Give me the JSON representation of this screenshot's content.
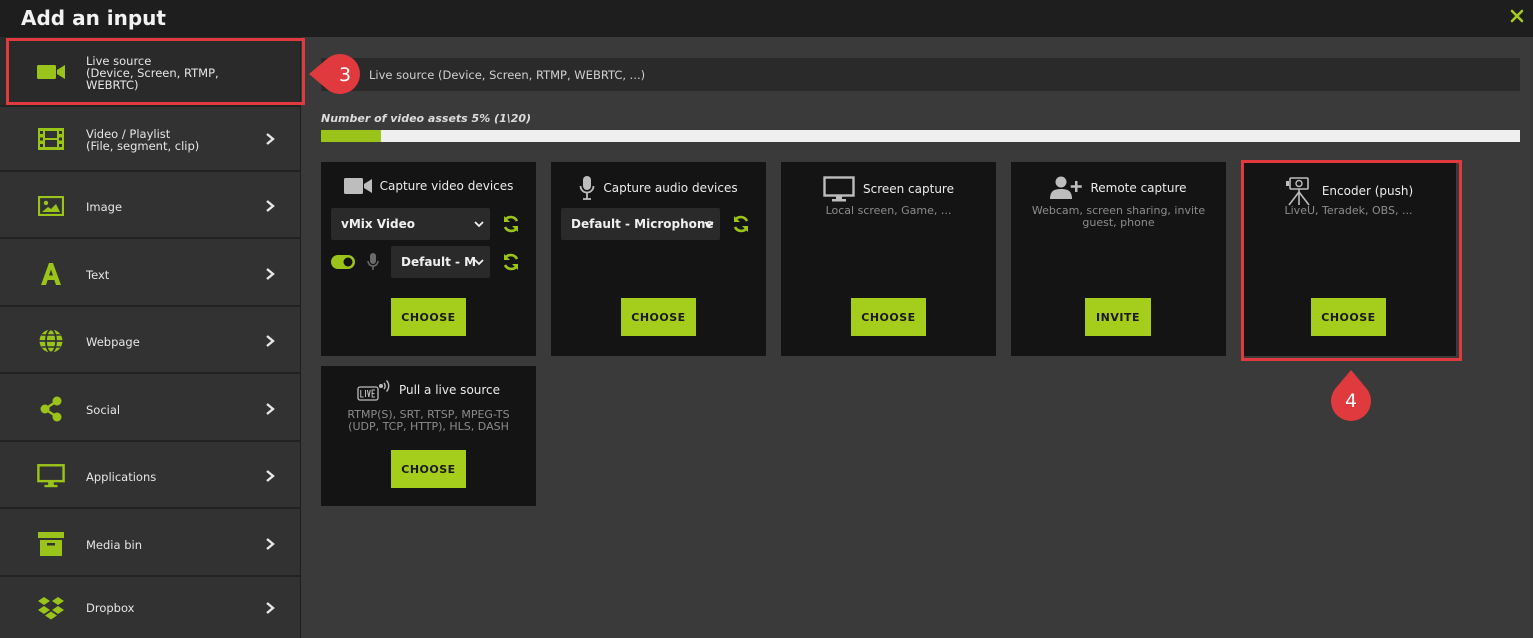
{
  "window": {
    "title": "Add an input",
    "close_icon": "close-x-icon"
  },
  "colors": {
    "accent": "#a5cd1b",
    "highlight": "#e0393e",
    "background": "#3a3a3a",
    "card": "#141414"
  },
  "sidebar": {
    "items": [
      {
        "line1": "Live source",
        "line2": "(Device, Screen, RTMP,",
        "line3": "WEBRTC)",
        "icon": "video-camera-icon"
      },
      {
        "line1": "Video / Playlist",
        "line2": "(File, segment, clip)",
        "icon": "film-icon"
      },
      {
        "line1": "Image",
        "icon": "image-icon"
      },
      {
        "line1": "Text",
        "icon": "text-icon"
      },
      {
        "line1": "Webpage",
        "icon": "globe-icon"
      },
      {
        "line1": "Social",
        "icon": "share-icon"
      },
      {
        "line1": "Applications",
        "icon": "monitor-icon"
      },
      {
        "line1": "Media bin",
        "icon": "archive-icon"
      },
      {
        "line1": "Dropbox",
        "icon": "dropbox-icon"
      }
    ]
  },
  "main": {
    "search_placeholder": "Live source (Device, Screen, RTMP, WEBRTC, ...)",
    "assets_label": "Number of video assets 5% (1\\20)",
    "assets_percent": 5
  },
  "cards": {
    "capture_video": {
      "title": "Capture video devices",
      "device": "vMix Video",
      "audio": "Default - M",
      "button": "CHOOSE"
    },
    "capture_audio": {
      "title": "Capture audio devices",
      "device": "Default - Microphone",
      "button": "CHOOSE"
    },
    "screen_capture": {
      "title": "Screen capture",
      "desc": "Local screen, Game, ...",
      "button": "CHOOSE"
    },
    "remote_capture": {
      "title": "Remote capture",
      "desc1": "Webcam, screen sharing, invite",
      "desc2": "guest, phone",
      "button": "INVITE"
    },
    "encoder_push": {
      "title": "Encoder (push)",
      "desc": "LiveU, Teradek, OBS, ...",
      "button": "CHOOSE"
    },
    "pull_live": {
      "title": "Pull a live source",
      "desc1": "RTMP(S), SRT, RTSP, MPEG-TS",
      "desc2": "(UDP, TCP, HTTP), HLS, DASH",
      "button": "CHOOSE"
    }
  },
  "callouts": {
    "step3": "3",
    "step4": "4"
  }
}
